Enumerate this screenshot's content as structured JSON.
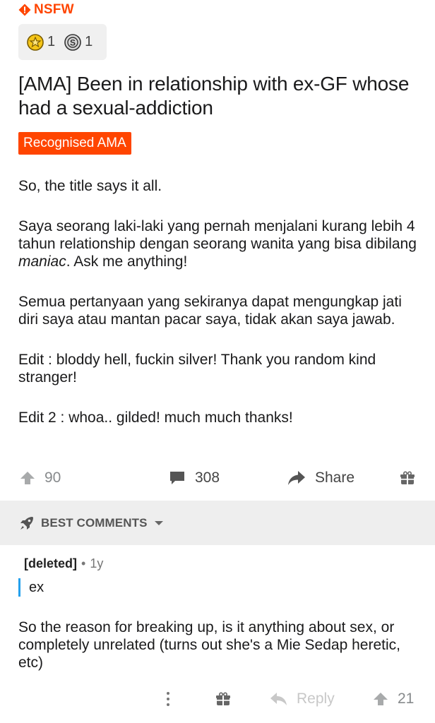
{
  "post": {
    "nsfw_label": "NSFW",
    "awards": [
      {
        "icon": "gold-award-icon",
        "count": "1"
      },
      {
        "icon": "silver-award-icon",
        "count": "1"
      }
    ],
    "title": "[AMA] Been in relationship with ex-GF whose had a sexual-addiction",
    "flair": "Recognised AMA",
    "body": {
      "p1": "So, the title says it all.",
      "p2_before": "Saya seorang laki-laki yang pernah menjalani kurang lebih 4 tahun relationship dengan seorang wanita yang bisa dibilang ",
      "p2_italic": "maniac",
      "p2_after": ". Ask me anything!",
      "p3": "Semua pertanyaan yang sekiranya dapat mengungkap jati diri saya atau mantan pacar saya, tidak akan saya jawab.",
      "p4": "Edit : bloddy hell, fuckin silver! Thank you random kind stranger!",
      "p5": "Edit 2 : whoa.. gilded! much much thanks!"
    },
    "votes": "90",
    "comments": "308",
    "share_label": "Share"
  },
  "comments_section": {
    "sort_label": "BEST COMMENTS"
  },
  "comment": {
    "author": "[deleted]",
    "separator": "•",
    "age": "1y",
    "quote": "ex",
    "text": "So the reason for breaking up, is it anything about sex, or completely unrelated (turns out she's a Mie Sedap heretic, etc)",
    "reply_label": "Reply",
    "votes": "21"
  },
  "colors": {
    "accent": "#ff4500",
    "quote_bar": "#24a0ed",
    "section_bg": "#eeeeee",
    "muted": "#878a8c"
  }
}
